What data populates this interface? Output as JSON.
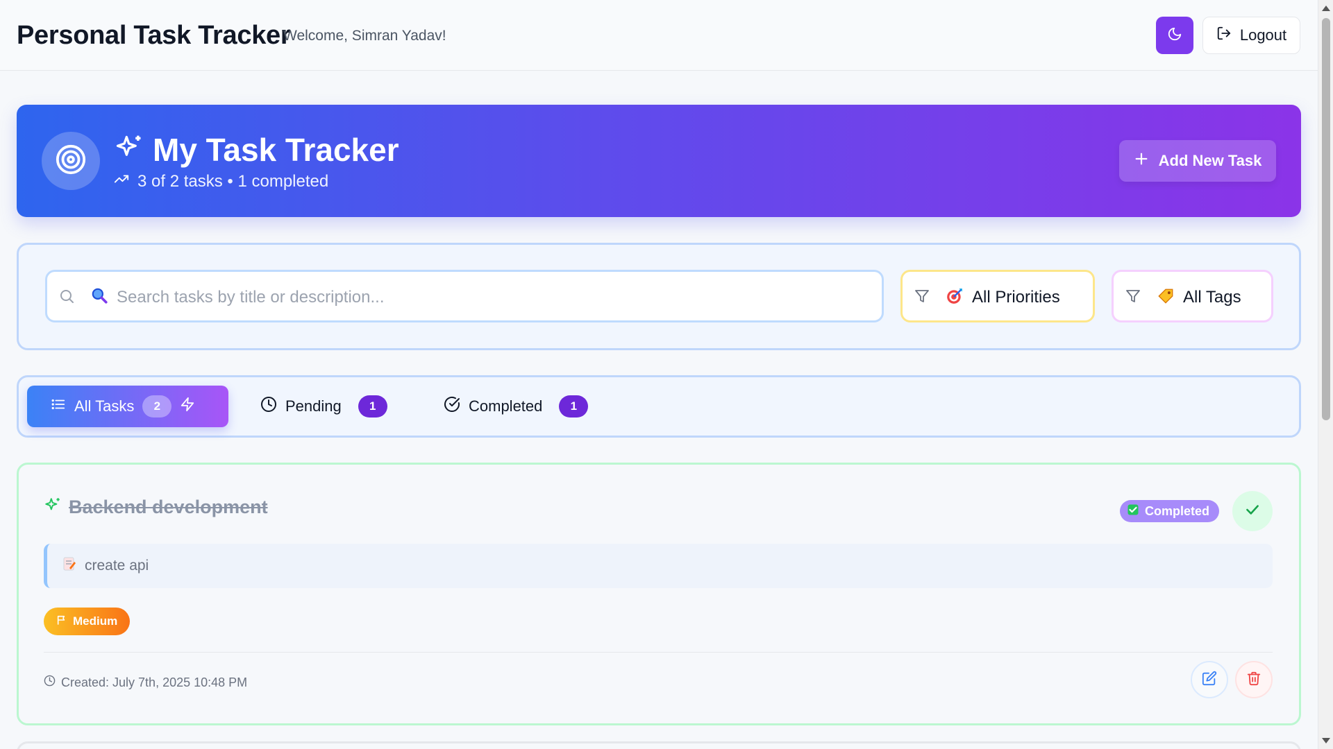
{
  "header": {
    "app_title": "Personal Task Tracker",
    "welcome": "Welcome, Simran Yadav!",
    "theme_icon": "moon-icon",
    "logout_label": "Logout",
    "logout_icon": "logout-icon"
  },
  "hero": {
    "logo_icon": "target-icon",
    "sparkles_icon": "sparkles-icon",
    "title": "My Task Tracker",
    "trend_icon": "trending-up-icon",
    "subtitle": "3 of 2 tasks • 1 completed",
    "add_label": "Add New Task",
    "add_icon": "plus-icon"
  },
  "filters": {
    "search_icon": "search-icon",
    "search_emoji": "🔍",
    "search_placeholder": "Search tasks by title or description...",
    "priority_icon": "filter-icon",
    "priority_emoji": "🎯",
    "priority_value": "All Priorities",
    "tags_icon": "filter-icon",
    "tags_emoji": "🏷️",
    "tags_value": "All Tags"
  },
  "tabs": [
    {
      "label": "All Tasks",
      "count": "2",
      "icon": "list-icon",
      "active": true,
      "extra_icon": "zap-icon"
    },
    {
      "label": "Pending",
      "count": "1",
      "icon": "clock-icon",
      "active": false
    },
    {
      "label": "Completed",
      "count": "1",
      "icon": "check-circle-icon",
      "active": false
    }
  ],
  "tasks": [
    {
      "title": "Backend development",
      "title_icon": "sparkles-icon",
      "status": "Completed",
      "status_emoji": "✅",
      "description_emoji": "📝",
      "description": "create api",
      "priority": "Medium",
      "priority_icon": "flag-icon",
      "created": "Created: July 7th, 2025 10:48 PM",
      "created_icon": "clock-icon",
      "completed": true
    }
  ],
  "colors": {
    "accent": "#7c3aed",
    "hero_start": "#2e65ee",
    "hero_end": "#8b34e8",
    "completed_badge": "#a78bfa",
    "medium_priority": "#f59e0b"
  }
}
